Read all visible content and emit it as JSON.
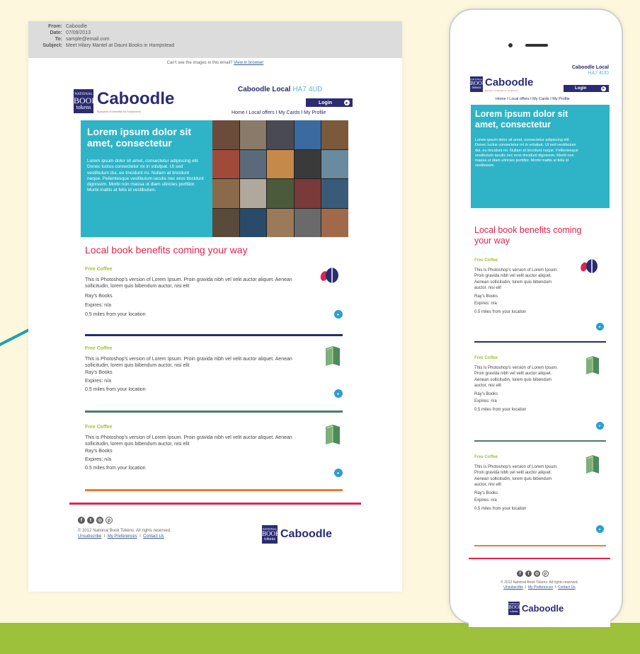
{
  "email_header": {
    "from_label": "From:",
    "from": "Caboodle",
    "date_label": "Date:",
    "date": "07/09/2013",
    "to_label": "To:",
    "to": "sample@email.com",
    "subject_label": "Subject:",
    "subject": "Meet Hilary Mantel at Daunt Books in Hampstead",
    "view_text": "Can't see the images in this email?",
    "view_link": "View in browser"
  },
  "brand": {
    "nbt_top": "NATIONAL",
    "nbt_mid": "BOOK",
    "nbt_bot": "tokens",
    "name": "Caboodle",
    "tagline": "Bumpers of benefits for booklovers"
  },
  "header": {
    "local_title": "Caboodle Local",
    "postcode": "HA7 4UD",
    "login": "Login",
    "nav": "Home  I  Local offers  I  My Cards  I  My Profile"
  },
  "hero": {
    "title": "Lorem ipsum dolor sit amet, consectetur",
    "body": "Lorem ipsum dolor sit amet, consectetur adipiscing elit. Donec luctus consectetur mi in volutpat. Ut sed vestibulum dui, eu tincidunt mi. Nullam at tincidunt neque. Pellentesque vestibulum iaculis nec eros tincidunt dignissim. Morbi non massa ut diam ultricies porttitor. Morbi mattis at felis id vestibulum."
  },
  "benefits_title": "Local book benefits coming your way",
  "offers": [
    {
      "title": "Free Coffee",
      "desc": "This is Photoshop's version  of Lorem Ipsum. Proin gravida nibh vel velit auctor aliquet. Aenean sollicitudin, lorem quis bibendum auctor, nisi elit",
      "shop": "Ray's Books",
      "expires": "Expires: n/a",
      "distance": "0.5 miles from your location",
      "icon": "coffee-logo-icon",
      "rule_color": "#2a2b72"
    },
    {
      "title": "Free Coffee",
      "desc": "This is Photoshop's version  of Lorem Ipsum. Proin gravida nibh vel velit auctor aliquet. Aenean sollicitudin, lorem quis bibendum auctor, nisi elit",
      "shop": "Ray's Books",
      "expires": "Expires: n/a",
      "distance": "0.5 miles from your location",
      "icon": "book-icon",
      "rule_color": "#4c7a66"
    },
    {
      "title": "Free Coffee",
      "desc": "This is Photoshop's version  of Lorem Ipsum. Proin gravida nibh vel velit auctor aliquet. Aenean sollicitudin, lorem quis bibendum auctor, nisi elit",
      "shop": "Ray's Books",
      "expires": "Expires: n/a",
      "distance": "0.5 miles from your location",
      "icon": "book-icon",
      "rule_color": "#f07a2a"
    }
  ],
  "footer": {
    "copyright": "© 2012 National Book Tokens. All rights reserved.",
    "unsubscribe": "Unsubscribe",
    "preferences": "My Preferences",
    "contact": "Contact Us",
    "sep": "I",
    "social": [
      "facebook-icon",
      "twitter-icon",
      "instagram-icon",
      "pinterest-icon"
    ]
  },
  "colors": {
    "accent": "#2a2b72",
    "teal": "#2fb3c7",
    "pink": "#e0234f",
    "green": "#9dc13b",
    "button": "#2a9fcf"
  }
}
